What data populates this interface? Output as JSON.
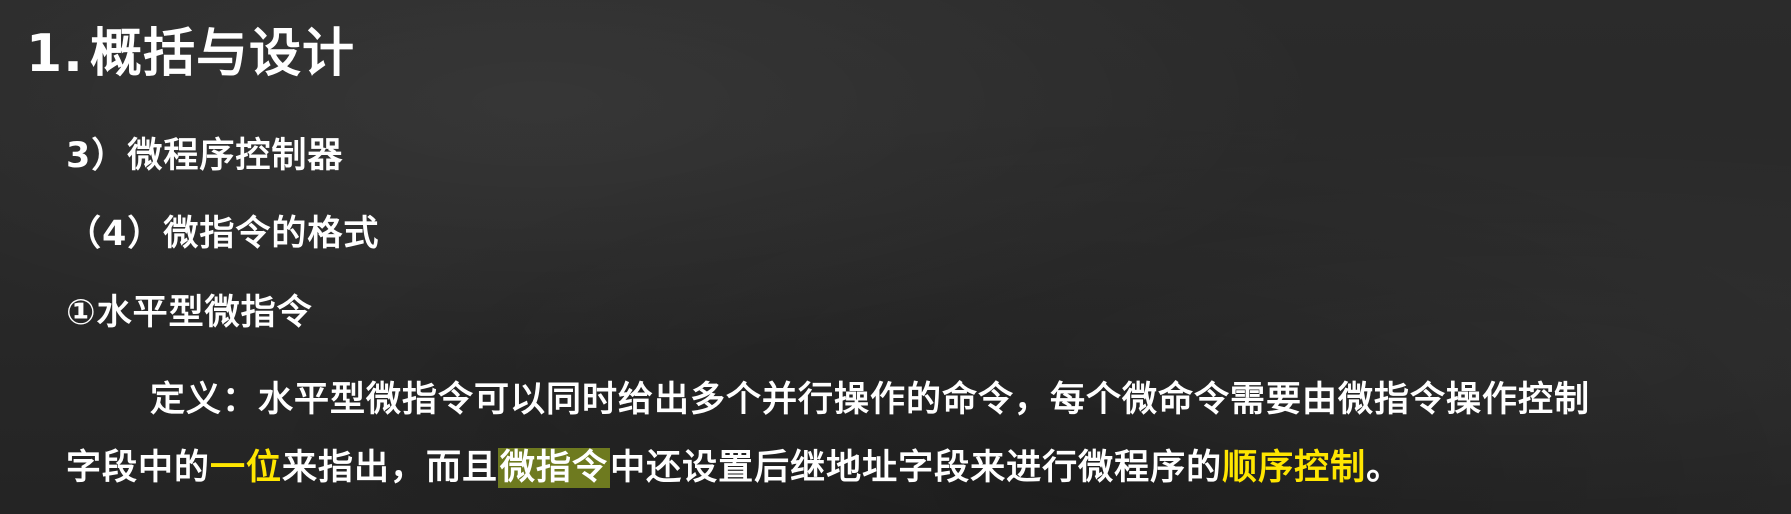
{
  "slide": {
    "title_number": "1.",
    "title_text": "概括与设计",
    "heading_3": "3）微程序控制器",
    "heading_4": "（4）微指令的格式",
    "heading_5": "①水平型微指令",
    "definition": {
      "line1": "定义：水平型微指令可以同时给出多个并行操作的命令，每个微命令需要由微指令操作控制",
      "line2_part1": "字段中的",
      "line2_em1": "一位",
      "line2_part2": "来指出，而且",
      "line2_hl": "微指令",
      "line2_part3": "中还设置后继地址字段来进行微程序的",
      "line2_em2": "顺序控制",
      "line2_end": "。"
    }
  },
  "colors": {
    "background": "#282828",
    "text": "#ffffff",
    "emphasis": "#ffe600",
    "highlight": "#6e7a1f"
  }
}
